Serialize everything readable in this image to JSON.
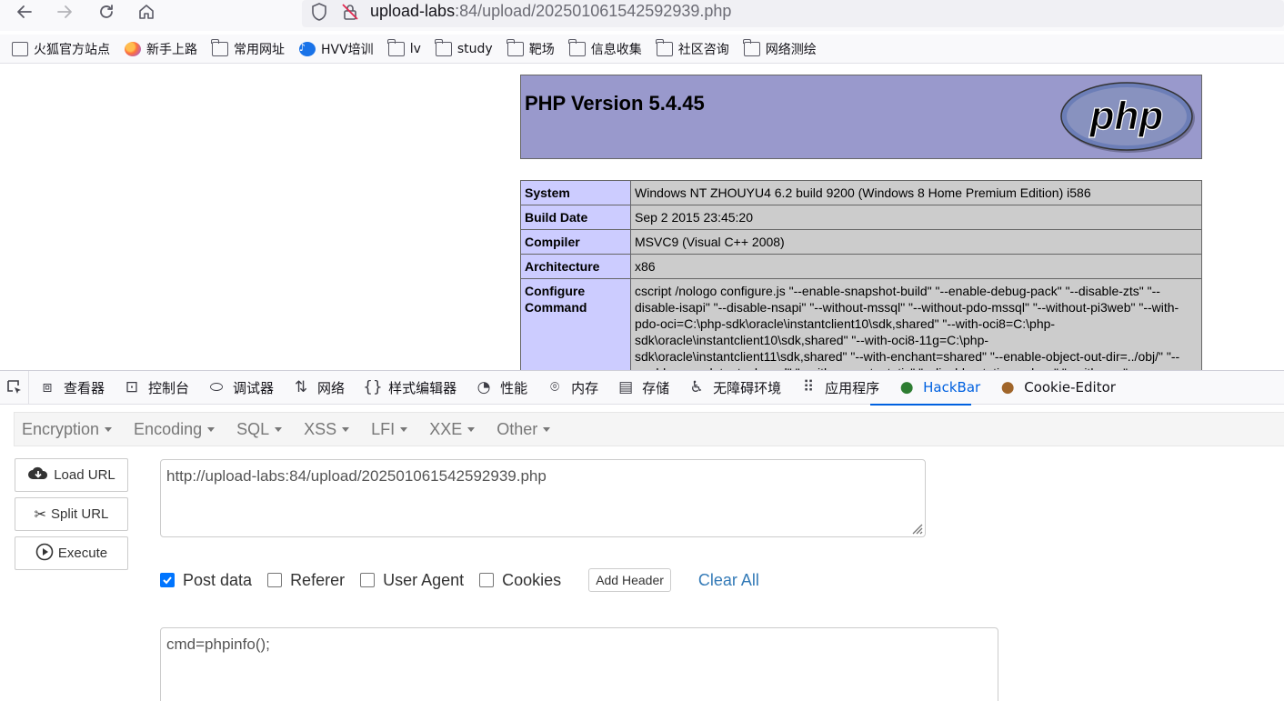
{
  "browser": {
    "url_host": "upload-labs",
    "url_rest": ":84/upload/202501061542592939.php"
  },
  "bookmarks": [
    {
      "label": "火狐官方站点",
      "icon": "page-icon"
    },
    {
      "label": "新手上路",
      "icon": "firefox-icon"
    },
    {
      "label": "常用网址",
      "icon": "folder-icon"
    },
    {
      "label": "HVV培训",
      "icon": "hvv-icon"
    },
    {
      "label": "lv",
      "icon": "folder-icon"
    },
    {
      "label": "study",
      "icon": "folder-icon"
    },
    {
      "label": "靶场",
      "icon": "folder-icon"
    },
    {
      "label": "信息收集",
      "icon": "folder-icon"
    },
    {
      "label": "社区咨询",
      "icon": "folder-icon"
    },
    {
      "label": "网络测绘",
      "icon": "folder-icon"
    }
  ],
  "phpinfo": {
    "title": "PHP Version 5.4.45",
    "logo_text": "php",
    "rows": [
      {
        "key": "System",
        "value": "Windows NT ZHOUYU4 6.2 build 9200 (Windows 8 Home Premium Edition) i586"
      },
      {
        "key": "Build Date",
        "value": "Sep 2 2015 23:45:20"
      },
      {
        "key": "Compiler",
        "value": "MSVC9 (Visual C++ 2008)"
      },
      {
        "key": "Architecture",
        "value": "x86"
      },
      {
        "key": "Configure Command",
        "value": "cscript /nologo configure.js \"--enable-snapshot-build\" \"--enable-debug-pack\" \"--disable-zts\" \"--disable-isapi\" \"--disable-nsapi\" \"--without-mssql\" \"--without-pdo-mssql\" \"--without-pi3web\" \"--with-pdo-oci=C:\\php-sdk\\oracle\\instantclient10\\sdk,shared\" \"--with-oci8=C:\\php-sdk\\oracle\\instantclient10\\sdk,shared\" \"--with-oci8-11g=C:\\php-sdk\\oracle\\instantclient11\\sdk,shared\" \"--with-enchant=shared\" \"--enable-object-out-dir=../obj/\" \"--enable-com-dotnet=shared\" \"--with-mcrypt=static\" \"--disable-static-analyze\" \"--with-pgo\""
      }
    ]
  },
  "devtools": {
    "tabs": [
      {
        "label": "查看器",
        "icon": "inspector-icon",
        "glyph": "⧈"
      },
      {
        "label": "控制台",
        "icon": "console-icon",
        "glyph": "⊡"
      },
      {
        "label": "调试器",
        "icon": "debugger-icon",
        "glyph": "⬭"
      },
      {
        "label": "网络",
        "icon": "network-icon",
        "glyph": "⇅"
      },
      {
        "label": "样式编辑器",
        "icon": "style-editor-icon",
        "glyph": "{}"
      },
      {
        "label": "性能",
        "icon": "performance-icon",
        "glyph": "◔"
      },
      {
        "label": "内存",
        "icon": "memory-icon",
        "glyph": "⌾"
      },
      {
        "label": "存储",
        "icon": "storage-icon",
        "glyph": "▤"
      },
      {
        "label": "无障碍环境",
        "icon": "accessibility-icon",
        "glyph": "♿"
      },
      {
        "label": "应用程序",
        "icon": "application-icon",
        "glyph": "⠿"
      },
      {
        "label": "HackBar",
        "icon": "hackbar-icon",
        "glyph": "●",
        "active": true
      },
      {
        "label": "Cookie-Editor",
        "icon": "cookie-icon",
        "glyph": "●"
      }
    ]
  },
  "hackbar": {
    "menu": [
      "Encryption",
      "Encoding",
      "SQL",
      "XSS",
      "LFI",
      "XXE",
      "Other"
    ],
    "load_url": "Load URL",
    "split_url": "Split URL",
    "execute": "Execute",
    "url_value": "http://upload-labs:84/upload/202501061542592939.php",
    "options": [
      {
        "label": "Post data",
        "checked": true
      },
      {
        "label": "Referer",
        "checked": false
      },
      {
        "label": "User Agent",
        "checked": false
      },
      {
        "label": "Cookies",
        "checked": false
      }
    ],
    "add_header": "Add Header",
    "clear_all": "Clear All",
    "post_value": "cmd=phpinfo();"
  },
  "colors": {
    "php_header_bg": "#9999cc",
    "php_key_bg": "#ccccff",
    "php_value_bg": "#cccccc",
    "active_tab": "#0061e0",
    "link": "#337ab7",
    "checkbox_checked": "#0075ff"
  }
}
